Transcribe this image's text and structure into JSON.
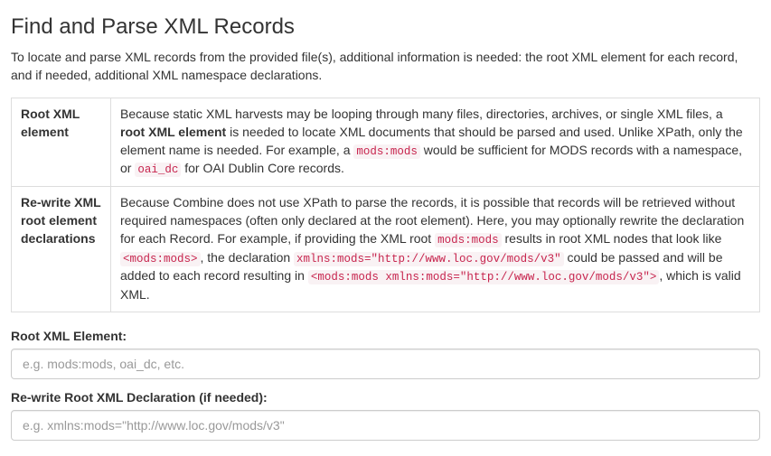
{
  "page": {
    "title": "Find and Parse XML Records",
    "intro": "To locate and parse XML records from the provided file(s), additional information is needed: the root XML element for each record, and if needed, additional XML namespace declarations."
  },
  "table": {
    "row1": {
      "label": "Root XML element",
      "t1": "Because static XML harvests may be looping through many files, directories, archives, or single XML files, a ",
      "bold": "root XML element",
      "t2": " is needed to locate XML documents that should be parsed and used. Unlike XPath, only the element name is needed. For example, a ",
      "code1": "mods:mods",
      "t3": " would be sufficient for MODS records with a namespace, or ",
      "code2": "oai_dc",
      "t4": " for OAI Dublin Core records."
    },
    "row2": {
      "label": "Re-write XML root element declarations",
      "t1": "Because Combine does not use XPath to parse the records, it is possible that records will be retrieved without required namespaces (often only declared at the root element). Here, you may optionally rewrite the declaration for each Record. For example, if providing the XML root ",
      "code1": "mods:mods",
      "t2": " results in root XML nodes that look like ",
      "code2": "<mods:mods>",
      "t3": ", the declaration ",
      "code3": "xmlns:mods=\"http://www.loc.gov/mods/v3\"",
      "t4": " could be passed and will be added to each record resulting in ",
      "code4": "<mods:mods xmlns:mods=\"http://www.loc.gov/mods/v3\">",
      "t5": ", which is valid XML."
    }
  },
  "form": {
    "label1": "Root XML Element:",
    "placeholder1": "e.g. mods:mods, oai_dc, etc.",
    "label2": "Re-write Root XML Declaration (if needed):",
    "placeholder2": "e.g. xmlns:mods=\"http://www.loc.gov/mods/v3\""
  }
}
